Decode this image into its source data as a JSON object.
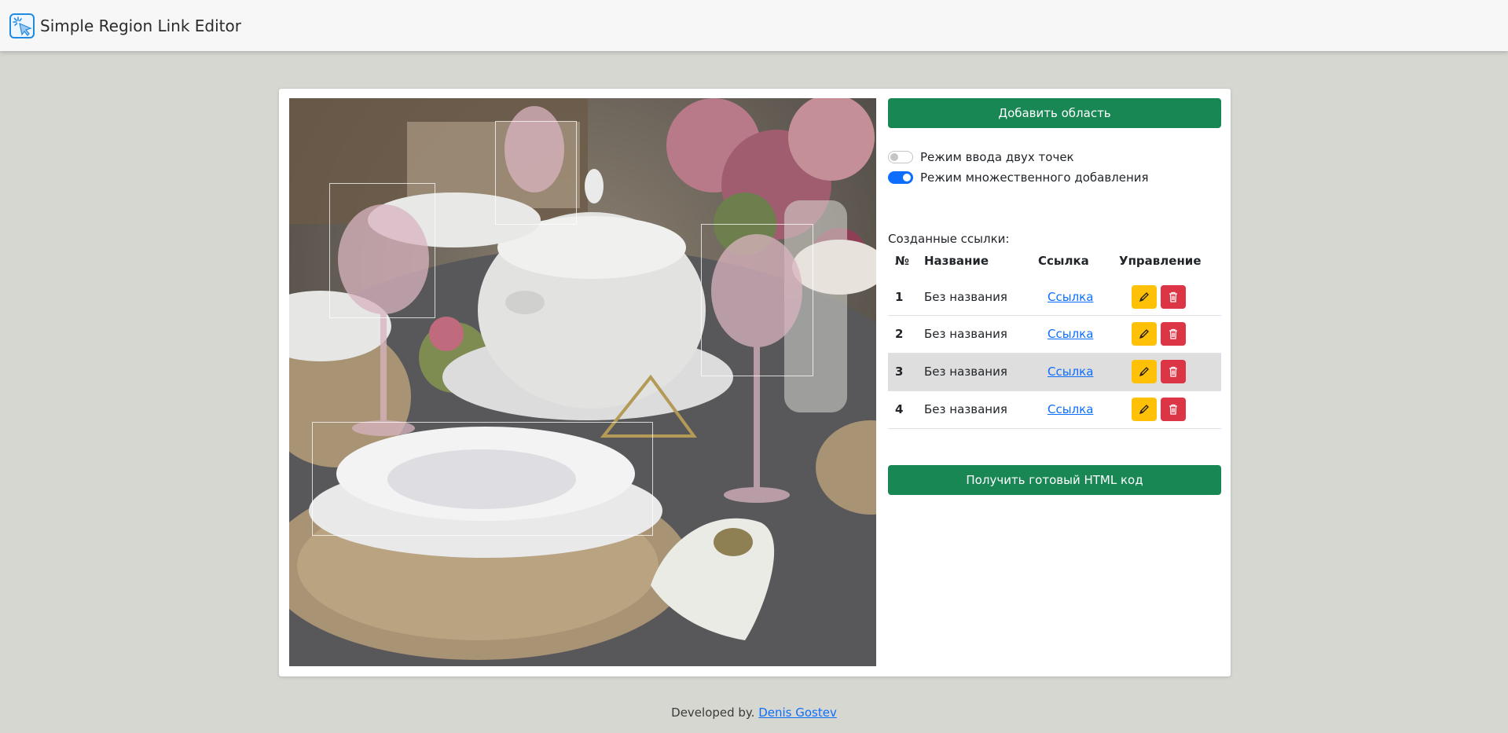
{
  "app": {
    "title": "Simple Region Link Editor",
    "icon": "cursor-click-icon"
  },
  "editor": {
    "image_description_icon": "photo-canvas",
    "regions_count": 4
  },
  "panel": {
    "add_region_label": "Добавить область",
    "toggles": [
      {
        "label": "Режим ввода двух точек",
        "on": false
      },
      {
        "label": "Режим множественного добавления",
        "on": true
      }
    ],
    "links_label": "Созданные ссылки:",
    "columns": [
      "№",
      "Название",
      "Ссылка",
      "Управление"
    ],
    "rows": [
      {
        "num": "1",
        "name": "Без названия",
        "link": "Ссылка"
      },
      {
        "num": "2",
        "name": "Без названия",
        "link": "Ссылка"
      },
      {
        "num": "3",
        "name": "Без названия",
        "link": "Ссылка"
      },
      {
        "num": "4",
        "name": "Без названия",
        "link": "Ссылка"
      }
    ],
    "get_html_label": "Получить готовый HTML код"
  },
  "footer": {
    "prefix": "Developed by.",
    "author": "Denis Gostev"
  },
  "colors": {
    "primary_green": "#198754",
    "edit_yellow": "#ffc107",
    "delete_red": "#dc3545",
    "link_blue": "#0d6efd",
    "page_bg": "#d6d7d1"
  }
}
